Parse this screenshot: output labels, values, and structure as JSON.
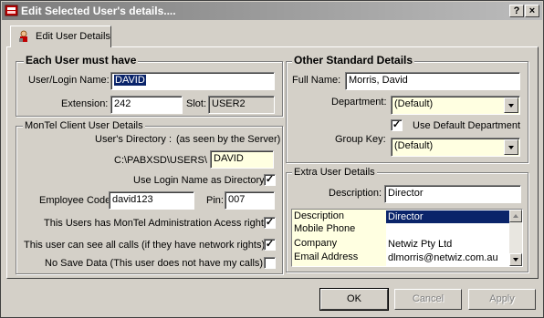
{
  "window": {
    "title": "Edit Selected User's details....",
    "help_label": "?",
    "close_label": "×"
  },
  "tab": {
    "label": "Edit User Details"
  },
  "must_have": {
    "title": "Each User must have",
    "login_label": "User/Login Name:",
    "login_value": "DAVID",
    "extension_label": "Extension:",
    "extension_value": "242",
    "slot_label": "Slot:",
    "slot_value": "USER2"
  },
  "client": {
    "title": "MonTel Client User Details",
    "dir_label": "User's Directory :",
    "dir_note": "(as seen by the Server)",
    "dir_path": "C:\\PABXSD\\USERS\\",
    "dir_value": "DAVID",
    "use_login_label": "Use Login Name as Directory",
    "use_login_checked": "✓",
    "emp_code_label": "Employee Code:",
    "emp_code_value": "david123",
    "pin_label": "Pin:",
    "pin_value": "007",
    "admin_label": "This Users has MonTel Administration Acess rights",
    "admin_checked": "✓",
    "see_calls_label": "This user can see all calls (if they have network rights).",
    "see_calls_checked": "✓",
    "no_save_label": "No Save Data (This user does not have my calls).",
    "no_save_checked": ""
  },
  "standard": {
    "title": "Other Standard Details",
    "fullname_label": "Full Name:",
    "fullname_value": "Morris, David",
    "department_label": "Department:",
    "department_value": "(Default)",
    "use_default_dept_label": "Use Default Department",
    "use_default_dept_checked": "✓",
    "group_key_label": "Group Key:",
    "group_key_value": "(Default)"
  },
  "extra": {
    "title": "Extra User Details",
    "description_label": "Description:",
    "description_value": "Director",
    "rows": [
      {
        "key": "Description",
        "value": "Director"
      },
      {
        "key": "Mobile Phone",
        "value": ""
      },
      {
        "key": "Company",
        "value": "Netwiz Pty Ltd"
      },
      {
        "key": "Email Address",
        "value": "dlmorris@netwiz.com.au"
      }
    ]
  },
  "buttons": {
    "ok": "OK",
    "cancel": "Cancel",
    "apply": "Apply"
  },
  "colors": {
    "selection": "#0a246a",
    "yellow_field": "#ffffe1",
    "face": "#d4d0c8"
  }
}
